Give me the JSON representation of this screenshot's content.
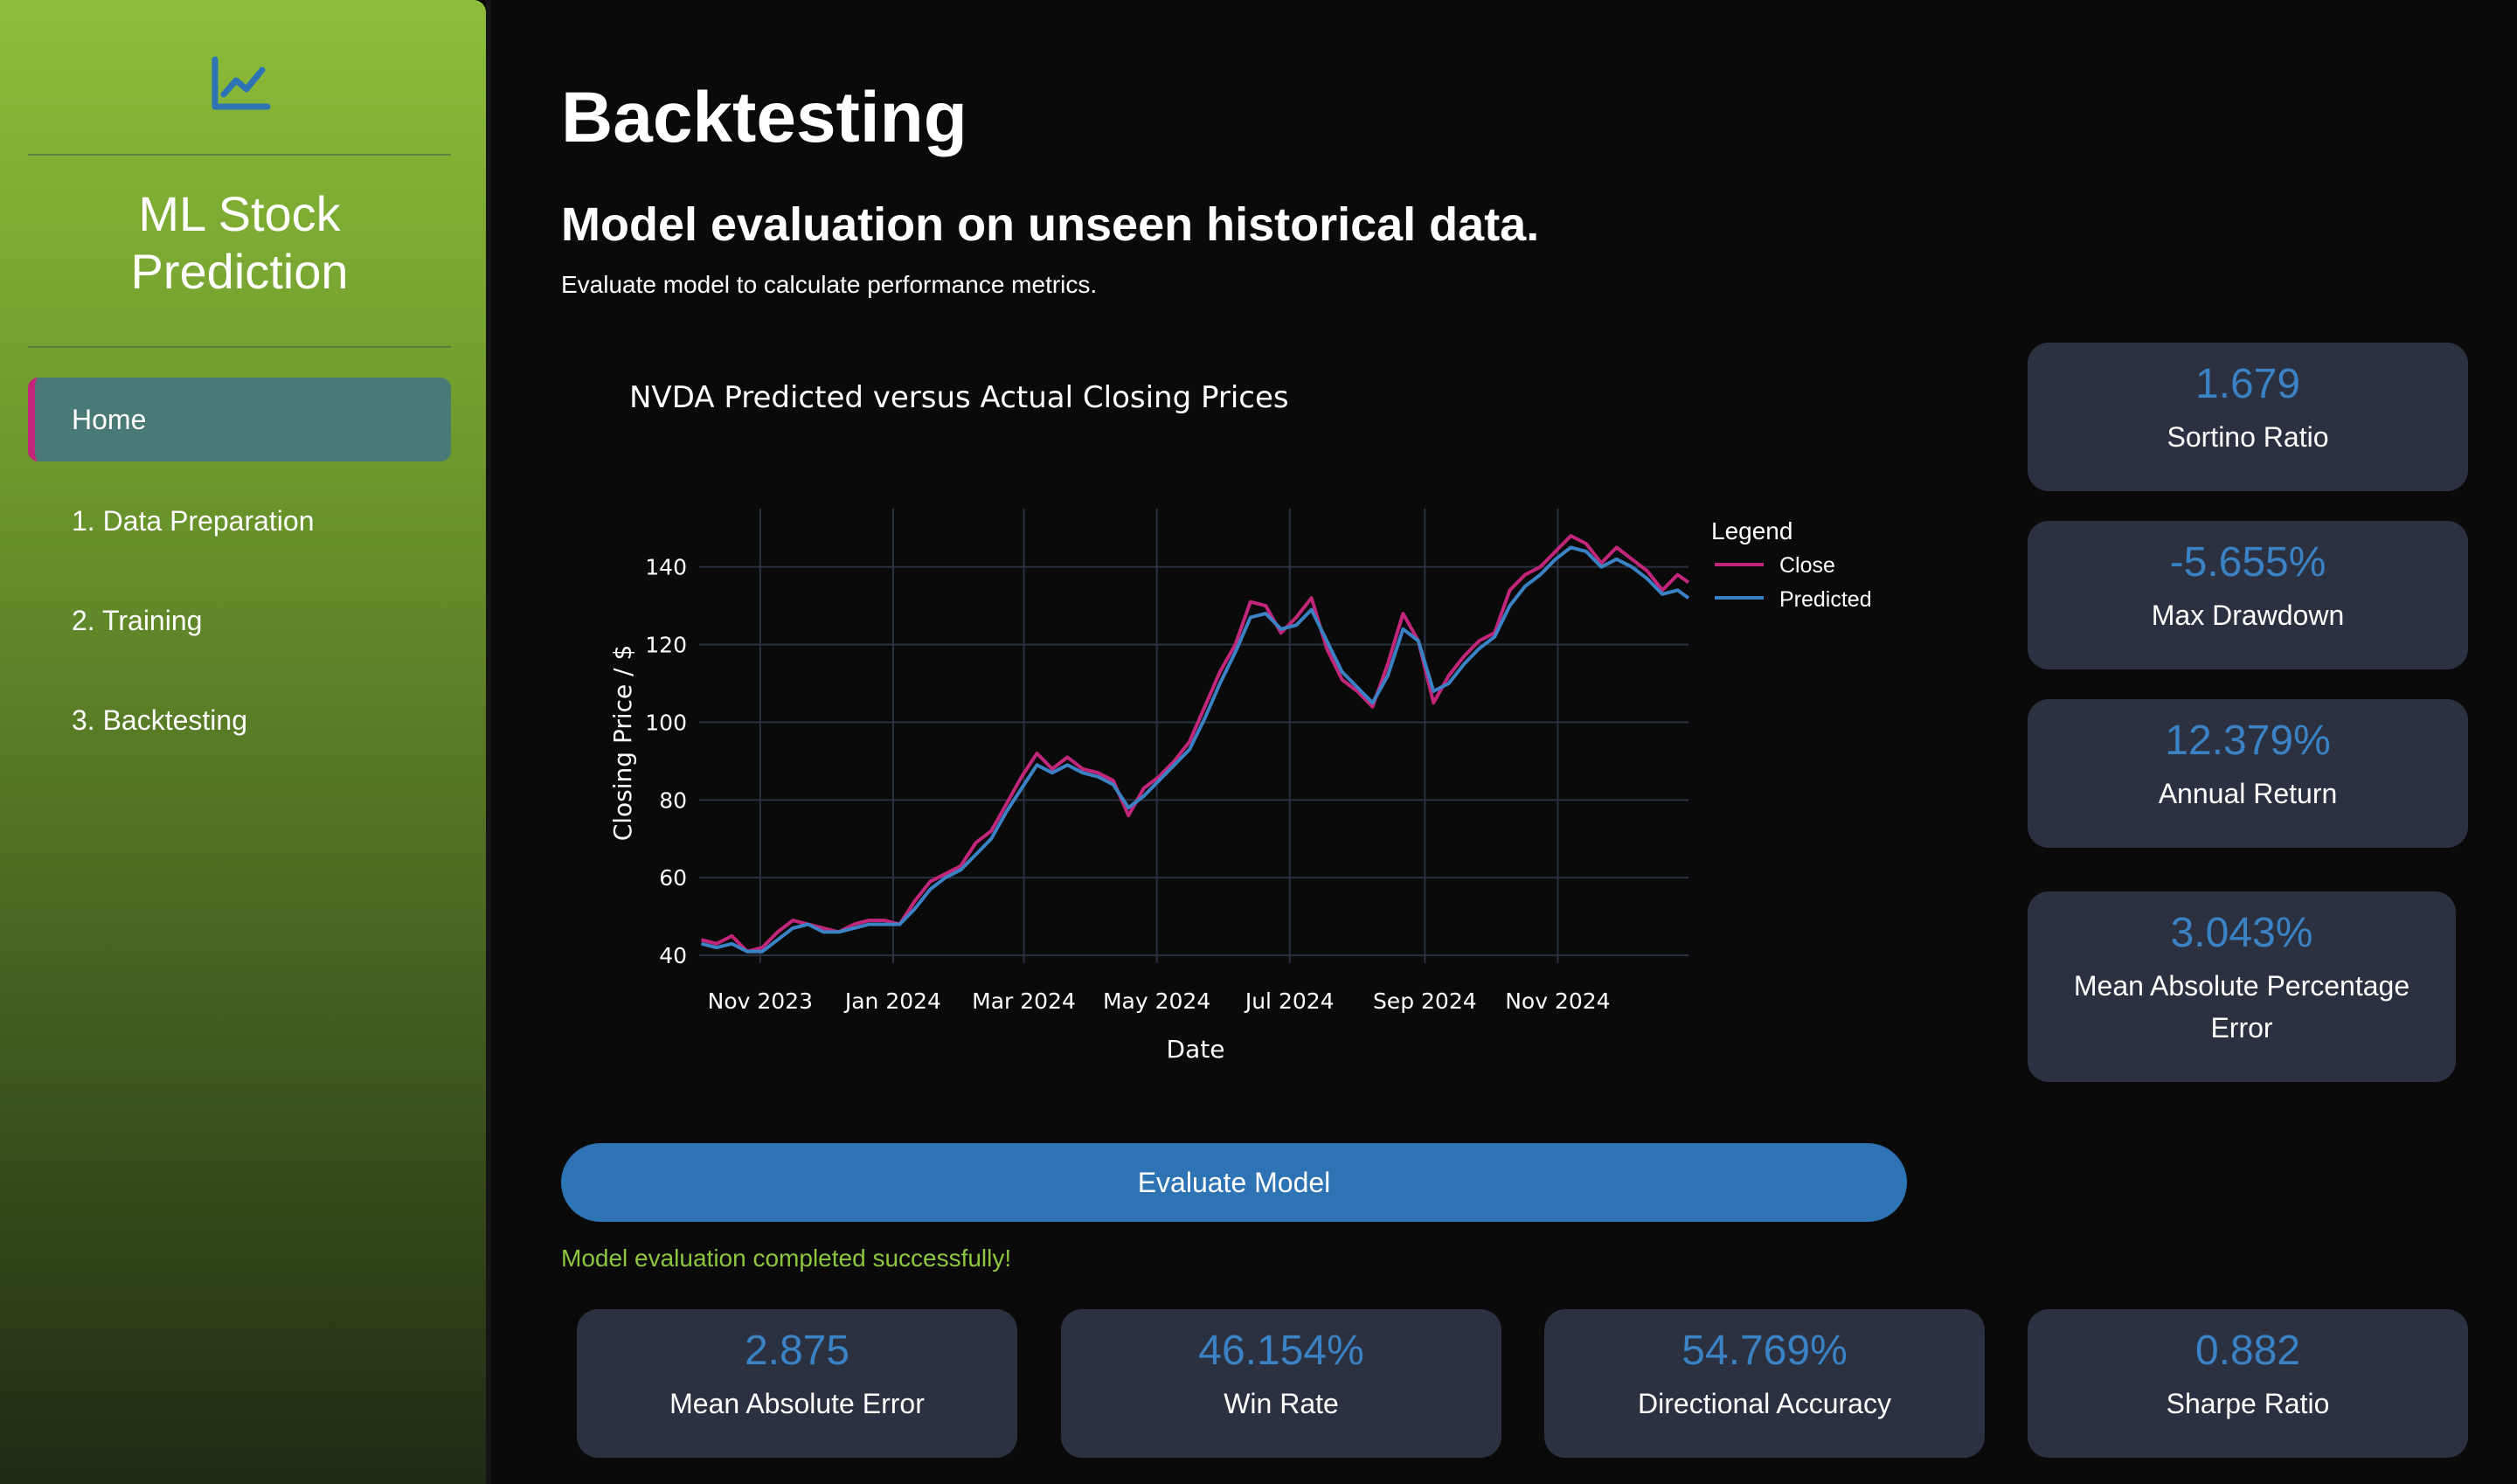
{
  "sidebar": {
    "app_title_line1": "ML Stock",
    "app_title_line2": "Prediction",
    "items": [
      {
        "label": "Home"
      },
      {
        "label": "1. Data Preparation"
      },
      {
        "label": "2. Training"
      },
      {
        "label": "3. Backtesting"
      }
    ]
  },
  "main": {
    "title": "Backtesting",
    "subtitle": "Model evaluation on unseen historical data.",
    "description": "Evaluate model to calculate performance metrics.",
    "evaluate_button": "Evaluate Model",
    "status_message": "Model evaluation completed successfully!"
  },
  "metrics_side": [
    {
      "value": "1.679",
      "label": "Sortino Ratio"
    },
    {
      "value": "-5.655%",
      "label": "Max Drawdown"
    },
    {
      "value": "12.379%",
      "label": "Annual Return"
    },
    {
      "value": "3.043%",
      "label": "Mean Absolute Percentage Error"
    }
  ],
  "metrics_bottom": [
    {
      "value": "2.875",
      "label": "Mean Absolute Error"
    },
    {
      "value": "46.154%",
      "label": "Win Rate"
    },
    {
      "value": "54.769%",
      "label": "Directional Accuracy"
    },
    {
      "value": "0.882",
      "label": "Sharpe Ratio"
    }
  ],
  "colors": {
    "accent": "#2e74b5",
    "close_series": "#c2267a",
    "predicted_series": "#3b82c4",
    "success": "#8ec63f"
  },
  "icons": {
    "logo": "line-chart-icon"
  },
  "chart_data": {
    "type": "line",
    "title": "NVDA Predicted versus Actual Closing Prices",
    "xlabel": "Date",
    "ylabel": "Closing Price / $",
    "legend_title": "Legend",
    "legend_position": "top-right",
    "grid": true,
    "ylim": [
      38,
      155
    ],
    "xlim": [
      "2023-10-04",
      "2024-12-31"
    ],
    "x_ticks": [
      {
        "date": "2023-11-01",
        "label": "Nov 2023"
      },
      {
        "date": "2024-01-01",
        "label": "Jan 2024"
      },
      {
        "date": "2024-03-01",
        "label": "Mar 2024"
      },
      {
        "date": "2024-05-01",
        "label": "May 2024"
      },
      {
        "date": "2024-07-01",
        "label": "Jul 2024"
      },
      {
        "date": "2024-09-01",
        "label": "Sep 2024"
      },
      {
        "date": "2024-11-01",
        "label": "Nov 2024"
      }
    ],
    "y_ticks": [
      40,
      60,
      80,
      100,
      120,
      140
    ],
    "x": [
      "2023-10-05",
      "2023-10-12",
      "2023-10-19",
      "2023-10-26",
      "2023-11-02",
      "2023-11-09",
      "2023-11-16",
      "2023-11-23",
      "2023-11-30",
      "2023-12-07",
      "2023-12-14",
      "2023-12-21",
      "2023-12-28",
      "2024-01-04",
      "2024-01-11",
      "2024-01-18",
      "2024-01-25",
      "2024-02-01",
      "2024-02-08",
      "2024-02-15",
      "2024-02-22",
      "2024-02-29",
      "2024-03-07",
      "2024-03-14",
      "2024-03-21",
      "2024-03-28",
      "2024-04-04",
      "2024-04-11",
      "2024-04-18",
      "2024-04-25",
      "2024-05-02",
      "2024-05-09",
      "2024-05-16",
      "2024-05-23",
      "2024-05-30",
      "2024-06-06",
      "2024-06-13",
      "2024-06-20",
      "2024-06-27",
      "2024-07-04",
      "2024-07-11",
      "2024-07-18",
      "2024-07-25",
      "2024-08-01",
      "2024-08-08",
      "2024-08-15",
      "2024-08-22",
      "2024-08-29",
      "2024-09-05",
      "2024-09-12",
      "2024-09-19",
      "2024-09-26",
      "2024-10-03",
      "2024-10-10",
      "2024-10-17",
      "2024-10-24",
      "2024-10-31",
      "2024-11-07",
      "2024-11-14",
      "2024-11-21",
      "2024-11-28",
      "2024-12-05",
      "2024-12-12",
      "2024-12-19",
      "2024-12-26",
      "2024-12-31"
    ],
    "series": [
      {
        "name": "Close",
        "values": [
          44,
          43,
          45,
          41,
          42,
          46,
          49,
          48,
          47,
          46,
          48,
          49,
          49,
          48,
          54,
          59,
          61,
          63,
          69,
          72,
          79,
          86,
          92,
          88,
          91,
          88,
          87,
          85,
          76,
          83,
          86,
          90,
          95,
          104,
          113,
          120,
          131,
          130,
          123,
          127,
          132,
          119,
          111,
          108,
          104,
          115,
          128,
          121,
          105,
          112,
          117,
          121,
          123,
          134,
          138,
          140,
          144,
          148,
          146,
          141,
          145,
          142,
          139,
          134,
          138,
          136
        ],
        "color": "#c2267a"
      },
      {
        "name": "Predicted",
        "values": [
          43,
          42,
          43,
          41,
          41,
          44,
          47,
          48,
          46,
          46,
          47,
          48,
          48,
          48,
          52,
          57,
          60,
          62,
          66,
          70,
          77,
          83,
          89,
          87,
          89,
          87,
          86,
          84,
          78,
          81,
          85,
          89,
          93,
          101,
          110,
          118,
          127,
          128,
          124,
          125,
          129,
          121,
          113,
          109,
          105,
          112,
          124,
          121,
          108,
          110,
          115,
          119,
          122,
          130,
          135,
          138,
          142,
          145,
          144,
          140,
          142,
          140,
          137,
          133,
          134,
          132
        ],
        "color": "#3b82c4"
      }
    ]
  }
}
